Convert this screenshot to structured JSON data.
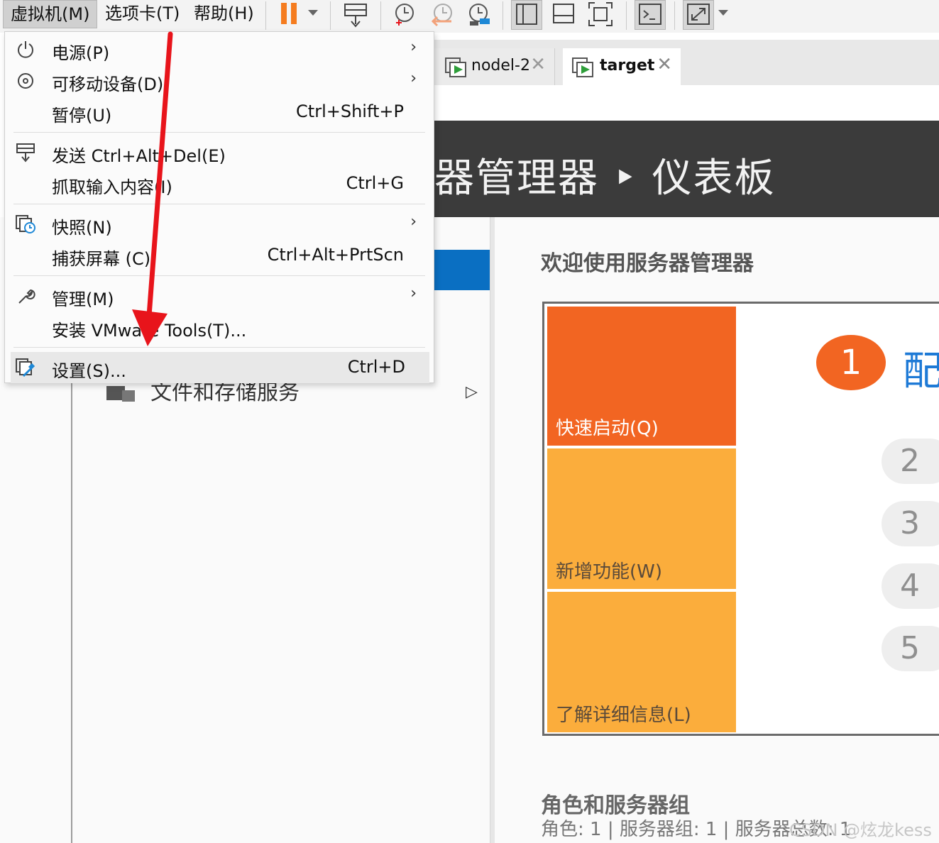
{
  "menubar": {
    "vm": "虚拟机(M)",
    "tabs": "选项卡(T)",
    "help": "帮助(H)"
  },
  "tabs": [
    {
      "label": "nodel-2"
    },
    {
      "label": "target"
    }
  ],
  "vm_menu": {
    "items": [
      {
        "label": "电源(P)",
        "shortcut": "",
        "submenu": true,
        "icon": "power-icon"
      },
      {
        "label": "可移动设备(D)",
        "shortcut": "",
        "submenu": true,
        "icon": "removable-device-icon"
      },
      {
        "label": "暂停(U)",
        "shortcut": "Ctrl+Shift+P",
        "submenu": false,
        "icon": ""
      },
      {
        "label": "发送 Ctrl+Alt+Del(E)",
        "shortcut": "",
        "submenu": false,
        "icon": "send-keys-icon"
      },
      {
        "label": "抓取输入内容(I)",
        "shortcut": "Ctrl+G",
        "submenu": false,
        "icon": ""
      },
      {
        "label": "快照(N)",
        "shortcut": "",
        "submenu": true,
        "icon": "snapshot-icon"
      },
      {
        "label": "捕获屏幕 (C)",
        "shortcut": "Ctrl+Alt+PrtScn",
        "submenu": false,
        "icon": ""
      },
      {
        "label": "管理(M)",
        "shortcut": "",
        "submenu": true,
        "icon": "wrench-icon"
      },
      {
        "label": "安装 VMware Tools(T)...",
        "shortcut": "",
        "submenu": false,
        "icon": ""
      },
      {
        "label": "设置(S)...",
        "shortcut": "Ctrl+D",
        "submenu": false,
        "icon": "settings-icon",
        "highlighted": true
      }
    ],
    "submenu_arrow": "›"
  },
  "server_manager": {
    "header": "器管理器 ‣ 仪表板",
    "left_item": "文件和存储服务",
    "left_item_arrow": "▷",
    "welcome": "欢迎使用服务器管理器",
    "tiles": [
      {
        "label": "快速启动(Q)"
      },
      {
        "label": "新增功能(W)"
      },
      {
        "label": "了解详细信息(L)"
      }
    ],
    "step1_number": "1",
    "step1_text": "配",
    "steps": [
      "2",
      "3",
      "4",
      "5"
    ],
    "roles_title": "角色和服务器组",
    "roles_summary": "角色: 1 | 服务器组: 1 | 服务器总数: 1"
  },
  "watermark": "CSDN @炫龙kess",
  "colors": {
    "accent_orange": "#f26522",
    "tile_amber": "#fbad3c",
    "header_dark": "#3b3b3b",
    "selected_blue": "#0a6fc2",
    "annotation_red": "#e8141b",
    "pause_orange": "#f57c1f"
  }
}
